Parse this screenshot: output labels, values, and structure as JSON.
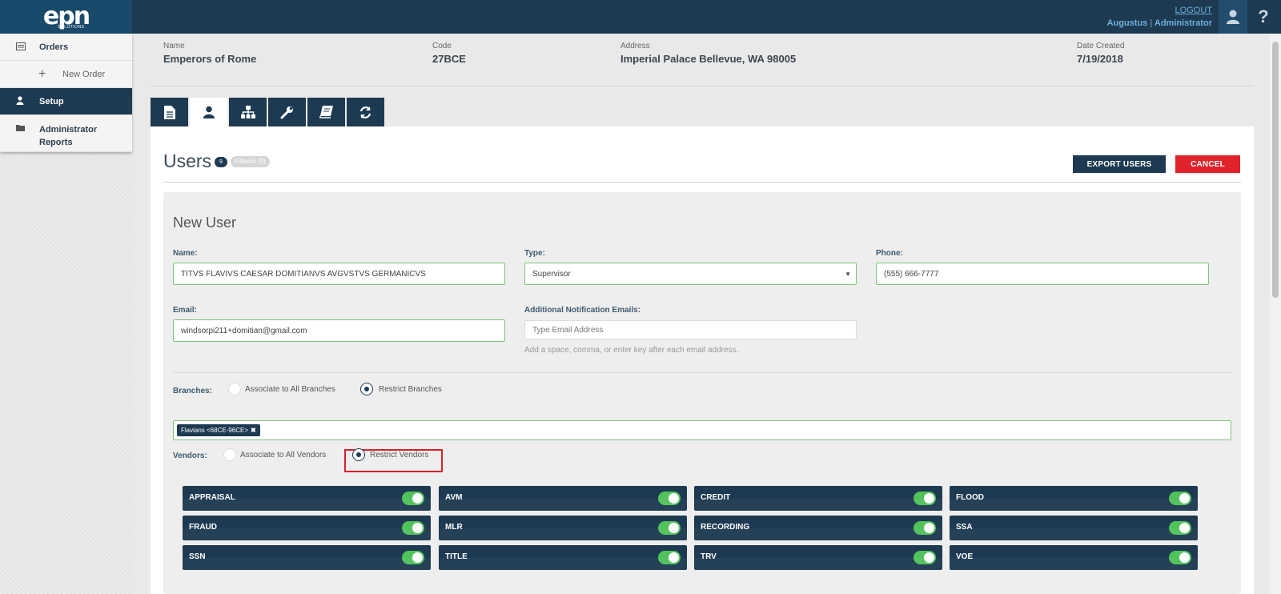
{
  "header": {
    "logo": "epn",
    "logo_sub": "SOLUTIONS",
    "logout": "LOGOUT",
    "user_name": "Augustus",
    "user_role": "Administrator",
    "help_glyph": "?"
  },
  "sidebar": {
    "items": [
      {
        "label": "Orders",
        "icon": "orders-icon"
      },
      {
        "label": "New Order",
        "icon": "plus-icon"
      },
      {
        "label": "Setup",
        "icon": "user-icon"
      },
      {
        "label": "Administrator Reports",
        "icon": "folder-icon"
      }
    ]
  },
  "info": {
    "name_label": "Name",
    "name": "Emperors of Rome",
    "code_label": "Code",
    "code": "27BCE",
    "address_label": "Address",
    "address": "Imperial Palace Bellevue, WA 98005",
    "date_label": "Date Created",
    "date": "7/19/2018"
  },
  "tabs": [
    "document-icon",
    "user-icon",
    "sitemap-icon",
    "wrench-icon",
    "book-icon",
    "refresh-icon"
  ],
  "users": {
    "title": "Users",
    "count": "9",
    "filtered": "Filtered (9)",
    "export_label": "EXPORT USERS",
    "cancel_label": "CANCEL"
  },
  "form": {
    "title": "New User",
    "name_label": "Name:",
    "name_value": "TITVS FLAVIVS CAESAR DOMITIANVS AVGVSTVS GERMANICVS",
    "type_label": "Type:",
    "type_value": "Supervisor",
    "phone_label": "Phone:",
    "phone_value": "(555) 666-7777",
    "email_label": "Email:",
    "email_value": "windsorpi211+domitian@gmail.com",
    "notif_label": "Additional Notification Emails:",
    "notif_placeholder": "Type Email Address",
    "notif_help": "Add a space, comma, or enter key after each email address.",
    "branches_label": "Branches:",
    "branch_all": "Associate to All Branches",
    "branch_restrict": "Restrict Branches",
    "branch_chip": "Flavians <68CE-96CE>",
    "vendors_label": "Vendors:",
    "vendor_all": "Associate to All Vendors",
    "vendor_restrict": "Restrict Vendors"
  },
  "vendors": [
    "APPRAISAL",
    "AVM",
    "CREDIT",
    "FLOOD",
    "FRAUD",
    "MLR",
    "RECORDING",
    "SSA",
    "SSN",
    "TITLE",
    "TRV",
    "VOE"
  ],
  "colors": {
    "navy": "#1d3a52",
    "accent_green": "#4fc25a",
    "cancel_red": "#e0222b"
  }
}
